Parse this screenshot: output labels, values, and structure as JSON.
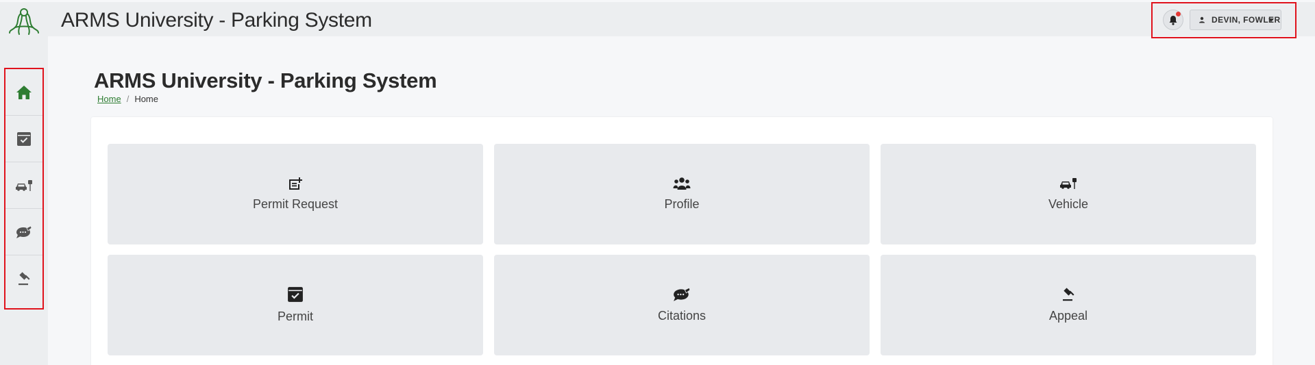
{
  "app": {
    "title": "ARMS University - Parking System"
  },
  "header": {
    "user_name": "DEVIN, FOWLER"
  },
  "page": {
    "title": "ARMS University - Parking System",
    "breadcrumb": {
      "link": "Home",
      "separator": "/",
      "current": "Home"
    }
  },
  "sidebar": {
    "items": [
      {
        "icon": "home-icon",
        "active": true
      },
      {
        "icon": "permit-calendar-icon"
      },
      {
        "icon": "vehicle-icon"
      },
      {
        "icon": "citation-icon"
      },
      {
        "icon": "appeal-gavel-icon"
      }
    ]
  },
  "tiles": [
    {
      "label": "Permit Request",
      "icon": "permit-request-icon"
    },
    {
      "label": "Profile",
      "icon": "users-icon"
    },
    {
      "label": "Vehicle",
      "icon": "vehicle-icon"
    },
    {
      "label": "Permit",
      "icon": "permit-calendar-icon"
    },
    {
      "label": "Citations",
      "icon": "citation-icon"
    },
    {
      "label": "Appeal",
      "icon": "appeal-gavel-icon"
    }
  ],
  "colors": {
    "accent": "#2e7d32",
    "highlight": "#e0121c",
    "notification": "#e53935"
  }
}
